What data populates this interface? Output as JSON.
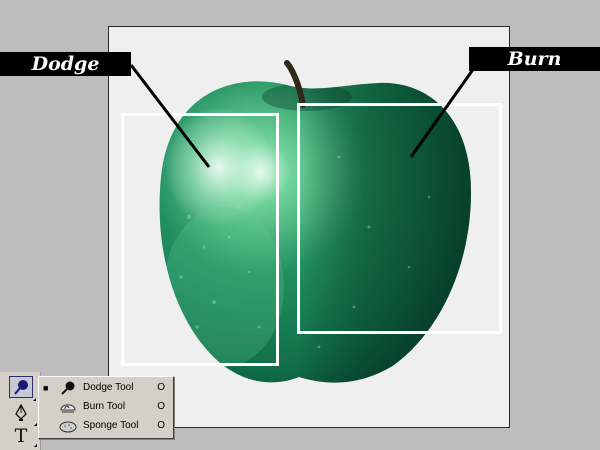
{
  "labels": {
    "dodge": "Dodge",
    "burn": "Burn"
  },
  "tool_menu": {
    "items": [
      {
        "label": "Dodge Tool",
        "shortcut": "O",
        "selected": true,
        "icon": "dodge-icon"
      },
      {
        "label": "Burn Tool",
        "shortcut": "O",
        "selected": false,
        "icon": "burn-icon"
      },
      {
        "label": "Sponge Tool",
        "shortcut": "O",
        "selected": false,
        "icon": "sponge-icon"
      }
    ],
    "selected_mark": "■"
  },
  "toolbox": {
    "type_tool_glyph": "T"
  },
  "colors": {
    "apple_green": "#1f8a5a",
    "apple_dark": "#0b4a33",
    "canvas_bg": "#efefef",
    "frame": "#ffffff"
  }
}
